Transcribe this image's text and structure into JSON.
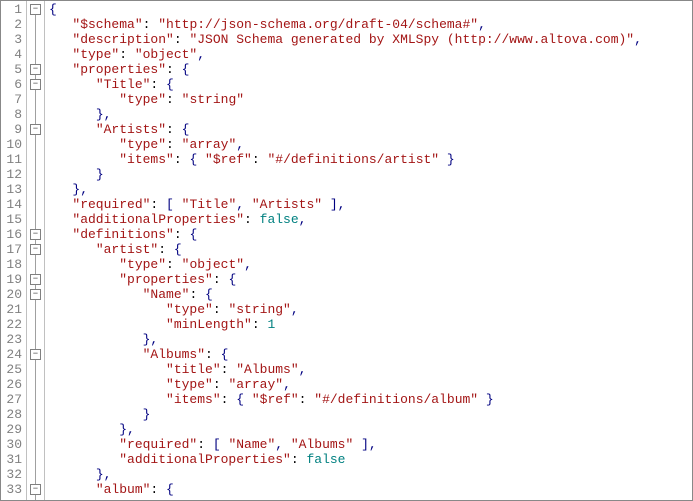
{
  "code_lines": [
    {
      "n": 1,
      "fold": "minus",
      "indent": "",
      "tokens": [
        {
          "t": "punc",
          "v": "{"
        }
      ]
    },
    {
      "n": 2,
      "fold": "",
      "indent": "   ",
      "tokens": [
        {
          "t": "key",
          "v": "\"$schema\""
        },
        {
          "t": "colon",
          "v": ": "
        },
        {
          "t": "str",
          "v": "\"http://json-schema.org/draft-04/schema#\""
        },
        {
          "t": "punc",
          "v": ","
        }
      ]
    },
    {
      "n": 3,
      "fold": "",
      "indent": "   ",
      "tokens": [
        {
          "t": "key",
          "v": "\"description\""
        },
        {
          "t": "colon",
          "v": ": "
        },
        {
          "t": "str",
          "v": "\"JSON Schema generated by XMLSpy (http://www.altova.com)\""
        },
        {
          "t": "punc",
          "v": ","
        }
      ]
    },
    {
      "n": 4,
      "fold": "",
      "indent": "   ",
      "tokens": [
        {
          "t": "key",
          "v": "\"type\""
        },
        {
          "t": "colon",
          "v": ": "
        },
        {
          "t": "str",
          "v": "\"object\""
        },
        {
          "t": "punc",
          "v": ","
        }
      ]
    },
    {
      "n": 5,
      "fold": "minus",
      "indent": "   ",
      "tokens": [
        {
          "t": "key",
          "v": "\"properties\""
        },
        {
          "t": "colon",
          "v": ": "
        },
        {
          "t": "punc",
          "v": "{"
        }
      ]
    },
    {
      "n": 6,
      "fold": "minus",
      "indent": "      ",
      "tokens": [
        {
          "t": "key",
          "v": "\"Title\""
        },
        {
          "t": "colon",
          "v": ": "
        },
        {
          "t": "punc",
          "v": "{"
        }
      ]
    },
    {
      "n": 7,
      "fold": "",
      "indent": "         ",
      "tokens": [
        {
          "t": "key",
          "v": "\"type\""
        },
        {
          "t": "colon",
          "v": ": "
        },
        {
          "t": "str",
          "v": "\"string\""
        }
      ]
    },
    {
      "n": 8,
      "fold": "",
      "indent": "      ",
      "tokens": [
        {
          "t": "punc",
          "v": "},"
        }
      ]
    },
    {
      "n": 9,
      "fold": "minus",
      "indent": "      ",
      "tokens": [
        {
          "t": "key",
          "v": "\"Artists\""
        },
        {
          "t": "colon",
          "v": ": "
        },
        {
          "t": "punc",
          "v": "{"
        }
      ]
    },
    {
      "n": 10,
      "fold": "",
      "indent": "         ",
      "tokens": [
        {
          "t": "key",
          "v": "\"type\""
        },
        {
          "t": "colon",
          "v": ": "
        },
        {
          "t": "str",
          "v": "\"array\""
        },
        {
          "t": "punc",
          "v": ","
        }
      ]
    },
    {
      "n": 11,
      "fold": "",
      "indent": "         ",
      "tokens": [
        {
          "t": "key",
          "v": "\"items\""
        },
        {
          "t": "colon",
          "v": ": "
        },
        {
          "t": "punc",
          "v": "{ "
        },
        {
          "t": "key",
          "v": "\"$ref\""
        },
        {
          "t": "colon",
          "v": ": "
        },
        {
          "t": "str",
          "v": "\"#/definitions/artist\""
        },
        {
          "t": "punc",
          "v": " }"
        }
      ]
    },
    {
      "n": 12,
      "fold": "",
      "indent": "      ",
      "tokens": [
        {
          "t": "punc",
          "v": "}"
        }
      ]
    },
    {
      "n": 13,
      "fold": "",
      "indent": "   ",
      "tokens": [
        {
          "t": "punc",
          "v": "},"
        }
      ]
    },
    {
      "n": 14,
      "fold": "",
      "indent": "   ",
      "tokens": [
        {
          "t": "key",
          "v": "\"required\""
        },
        {
          "t": "colon",
          "v": ": "
        },
        {
          "t": "punc",
          "v": "[ "
        },
        {
          "t": "str",
          "v": "\"Title\""
        },
        {
          "t": "punc",
          "v": ", "
        },
        {
          "t": "str",
          "v": "\"Artists\""
        },
        {
          "t": "punc",
          "v": " ],"
        }
      ]
    },
    {
      "n": 15,
      "fold": "",
      "indent": "   ",
      "tokens": [
        {
          "t": "key",
          "v": "\"additionalProperties\""
        },
        {
          "t": "colon",
          "v": ": "
        },
        {
          "t": "bool",
          "v": "false"
        },
        {
          "t": "punc",
          "v": ","
        }
      ]
    },
    {
      "n": 16,
      "fold": "minus",
      "indent": "   ",
      "tokens": [
        {
          "t": "key",
          "v": "\"definitions\""
        },
        {
          "t": "colon",
          "v": ": "
        },
        {
          "t": "punc",
          "v": "{"
        }
      ]
    },
    {
      "n": 17,
      "fold": "minus",
      "indent": "      ",
      "tokens": [
        {
          "t": "key",
          "v": "\"artist\""
        },
        {
          "t": "colon",
          "v": ": "
        },
        {
          "t": "punc",
          "v": "{"
        }
      ]
    },
    {
      "n": 18,
      "fold": "",
      "indent": "         ",
      "tokens": [
        {
          "t": "key",
          "v": "\"type\""
        },
        {
          "t": "colon",
          "v": ": "
        },
        {
          "t": "str",
          "v": "\"object\""
        },
        {
          "t": "punc",
          "v": ","
        }
      ]
    },
    {
      "n": 19,
      "fold": "minus",
      "indent": "         ",
      "tokens": [
        {
          "t": "key",
          "v": "\"properties\""
        },
        {
          "t": "colon",
          "v": ": "
        },
        {
          "t": "punc",
          "v": "{"
        }
      ]
    },
    {
      "n": 20,
      "fold": "minus",
      "indent": "            ",
      "tokens": [
        {
          "t": "key",
          "v": "\"Name\""
        },
        {
          "t": "colon",
          "v": ": "
        },
        {
          "t": "punc",
          "v": "{"
        }
      ]
    },
    {
      "n": 21,
      "fold": "",
      "indent": "               ",
      "tokens": [
        {
          "t": "key",
          "v": "\"type\""
        },
        {
          "t": "colon",
          "v": ": "
        },
        {
          "t": "str",
          "v": "\"string\""
        },
        {
          "t": "punc",
          "v": ","
        }
      ]
    },
    {
      "n": 22,
      "fold": "",
      "indent": "               ",
      "tokens": [
        {
          "t": "key",
          "v": "\"minLength\""
        },
        {
          "t": "colon",
          "v": ": "
        },
        {
          "t": "num",
          "v": "1"
        }
      ]
    },
    {
      "n": 23,
      "fold": "",
      "indent": "            ",
      "tokens": [
        {
          "t": "punc",
          "v": "},"
        }
      ]
    },
    {
      "n": 24,
      "fold": "minus",
      "indent": "            ",
      "tokens": [
        {
          "t": "key",
          "v": "\"Albums\""
        },
        {
          "t": "colon",
          "v": ": "
        },
        {
          "t": "punc",
          "v": "{"
        }
      ]
    },
    {
      "n": 25,
      "fold": "",
      "indent": "               ",
      "tokens": [
        {
          "t": "key",
          "v": "\"title\""
        },
        {
          "t": "colon",
          "v": ": "
        },
        {
          "t": "str",
          "v": "\"Albums\""
        },
        {
          "t": "punc",
          "v": ","
        }
      ]
    },
    {
      "n": 26,
      "fold": "",
      "indent": "               ",
      "tokens": [
        {
          "t": "key",
          "v": "\"type\""
        },
        {
          "t": "colon",
          "v": ": "
        },
        {
          "t": "str",
          "v": "\"array\""
        },
        {
          "t": "punc",
          "v": ","
        }
      ]
    },
    {
      "n": 27,
      "fold": "",
      "indent": "               ",
      "tokens": [
        {
          "t": "key",
          "v": "\"items\""
        },
        {
          "t": "colon",
          "v": ": "
        },
        {
          "t": "punc",
          "v": "{ "
        },
        {
          "t": "key",
          "v": "\"$ref\""
        },
        {
          "t": "colon",
          "v": ": "
        },
        {
          "t": "str",
          "v": "\"#/definitions/album\""
        },
        {
          "t": "punc",
          "v": " }"
        }
      ]
    },
    {
      "n": 28,
      "fold": "",
      "indent": "            ",
      "tokens": [
        {
          "t": "punc",
          "v": "}"
        }
      ]
    },
    {
      "n": 29,
      "fold": "",
      "indent": "         ",
      "tokens": [
        {
          "t": "punc",
          "v": "},"
        }
      ]
    },
    {
      "n": 30,
      "fold": "",
      "indent": "         ",
      "tokens": [
        {
          "t": "key",
          "v": "\"required\""
        },
        {
          "t": "colon",
          "v": ": "
        },
        {
          "t": "punc",
          "v": "[ "
        },
        {
          "t": "str",
          "v": "\"Name\""
        },
        {
          "t": "punc",
          "v": ", "
        },
        {
          "t": "str",
          "v": "\"Albums\""
        },
        {
          "t": "punc",
          "v": " ],"
        }
      ]
    },
    {
      "n": 31,
      "fold": "",
      "indent": "         ",
      "tokens": [
        {
          "t": "key",
          "v": "\"additionalProperties\""
        },
        {
          "t": "colon",
          "v": ": "
        },
        {
          "t": "bool",
          "v": "false"
        }
      ]
    },
    {
      "n": 32,
      "fold": "",
      "indent": "      ",
      "tokens": [
        {
          "t": "punc",
          "v": "},"
        }
      ]
    },
    {
      "n": 33,
      "fold": "minus",
      "indent": "      ",
      "tokens": [
        {
          "t": "key",
          "v": "\"album\""
        },
        {
          "t": "colon",
          "v": ": "
        },
        {
          "t": "punc",
          "v": "{"
        }
      ]
    }
  ]
}
